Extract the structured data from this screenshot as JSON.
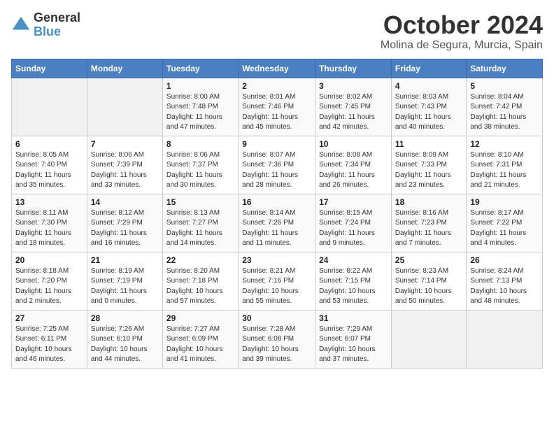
{
  "header": {
    "logo_general": "General",
    "logo_blue": "Blue",
    "month_title": "October 2024",
    "location": "Molina de Segura, Murcia, Spain"
  },
  "days_of_week": [
    "Sunday",
    "Monday",
    "Tuesday",
    "Wednesday",
    "Thursday",
    "Friday",
    "Saturday"
  ],
  "weeks": [
    [
      {
        "num": "",
        "info": ""
      },
      {
        "num": "",
        "info": ""
      },
      {
        "num": "1",
        "info": "Sunrise: 8:00 AM\nSunset: 7:48 PM\nDaylight: 11 hours and 47 minutes."
      },
      {
        "num": "2",
        "info": "Sunrise: 8:01 AM\nSunset: 7:46 PM\nDaylight: 11 hours and 45 minutes."
      },
      {
        "num": "3",
        "info": "Sunrise: 8:02 AM\nSunset: 7:45 PM\nDaylight: 11 hours and 42 minutes."
      },
      {
        "num": "4",
        "info": "Sunrise: 8:03 AM\nSunset: 7:43 PM\nDaylight: 11 hours and 40 minutes."
      },
      {
        "num": "5",
        "info": "Sunrise: 8:04 AM\nSunset: 7:42 PM\nDaylight: 11 hours and 38 minutes."
      }
    ],
    [
      {
        "num": "6",
        "info": "Sunrise: 8:05 AM\nSunset: 7:40 PM\nDaylight: 11 hours and 35 minutes."
      },
      {
        "num": "7",
        "info": "Sunrise: 8:06 AM\nSunset: 7:39 PM\nDaylight: 11 hours and 33 minutes."
      },
      {
        "num": "8",
        "info": "Sunrise: 8:06 AM\nSunset: 7:37 PM\nDaylight: 11 hours and 30 minutes."
      },
      {
        "num": "9",
        "info": "Sunrise: 8:07 AM\nSunset: 7:36 PM\nDaylight: 11 hours and 28 minutes."
      },
      {
        "num": "10",
        "info": "Sunrise: 8:08 AM\nSunset: 7:34 PM\nDaylight: 11 hours and 26 minutes."
      },
      {
        "num": "11",
        "info": "Sunrise: 8:09 AM\nSunset: 7:33 PM\nDaylight: 11 hours and 23 minutes."
      },
      {
        "num": "12",
        "info": "Sunrise: 8:10 AM\nSunset: 7:31 PM\nDaylight: 11 hours and 21 minutes."
      }
    ],
    [
      {
        "num": "13",
        "info": "Sunrise: 8:11 AM\nSunset: 7:30 PM\nDaylight: 11 hours and 18 minutes."
      },
      {
        "num": "14",
        "info": "Sunrise: 8:12 AM\nSunset: 7:29 PM\nDaylight: 11 hours and 16 minutes."
      },
      {
        "num": "15",
        "info": "Sunrise: 8:13 AM\nSunset: 7:27 PM\nDaylight: 11 hours and 14 minutes."
      },
      {
        "num": "16",
        "info": "Sunrise: 8:14 AM\nSunset: 7:26 PM\nDaylight: 11 hours and 11 minutes."
      },
      {
        "num": "17",
        "info": "Sunrise: 8:15 AM\nSunset: 7:24 PM\nDaylight: 11 hours and 9 minutes."
      },
      {
        "num": "18",
        "info": "Sunrise: 8:16 AM\nSunset: 7:23 PM\nDaylight: 11 hours and 7 minutes."
      },
      {
        "num": "19",
        "info": "Sunrise: 8:17 AM\nSunset: 7:22 PM\nDaylight: 11 hours and 4 minutes."
      }
    ],
    [
      {
        "num": "20",
        "info": "Sunrise: 8:18 AM\nSunset: 7:20 PM\nDaylight: 11 hours and 2 minutes."
      },
      {
        "num": "21",
        "info": "Sunrise: 8:19 AM\nSunset: 7:19 PM\nDaylight: 11 hours and 0 minutes."
      },
      {
        "num": "22",
        "info": "Sunrise: 8:20 AM\nSunset: 7:18 PM\nDaylight: 10 hours and 57 minutes."
      },
      {
        "num": "23",
        "info": "Sunrise: 8:21 AM\nSunset: 7:16 PM\nDaylight: 10 hours and 55 minutes."
      },
      {
        "num": "24",
        "info": "Sunrise: 8:22 AM\nSunset: 7:15 PM\nDaylight: 10 hours and 53 minutes."
      },
      {
        "num": "25",
        "info": "Sunrise: 8:23 AM\nSunset: 7:14 PM\nDaylight: 10 hours and 50 minutes."
      },
      {
        "num": "26",
        "info": "Sunrise: 8:24 AM\nSunset: 7:13 PM\nDaylight: 10 hours and 48 minutes."
      }
    ],
    [
      {
        "num": "27",
        "info": "Sunrise: 7:25 AM\nSunset: 6:11 PM\nDaylight: 10 hours and 46 minutes."
      },
      {
        "num": "28",
        "info": "Sunrise: 7:26 AM\nSunset: 6:10 PM\nDaylight: 10 hours and 44 minutes."
      },
      {
        "num": "29",
        "info": "Sunrise: 7:27 AM\nSunset: 6:09 PM\nDaylight: 10 hours and 41 minutes."
      },
      {
        "num": "30",
        "info": "Sunrise: 7:28 AM\nSunset: 6:08 PM\nDaylight: 10 hours and 39 minutes."
      },
      {
        "num": "31",
        "info": "Sunrise: 7:29 AM\nSunset: 6:07 PM\nDaylight: 10 hours and 37 minutes."
      },
      {
        "num": "",
        "info": ""
      },
      {
        "num": "",
        "info": ""
      }
    ]
  ]
}
